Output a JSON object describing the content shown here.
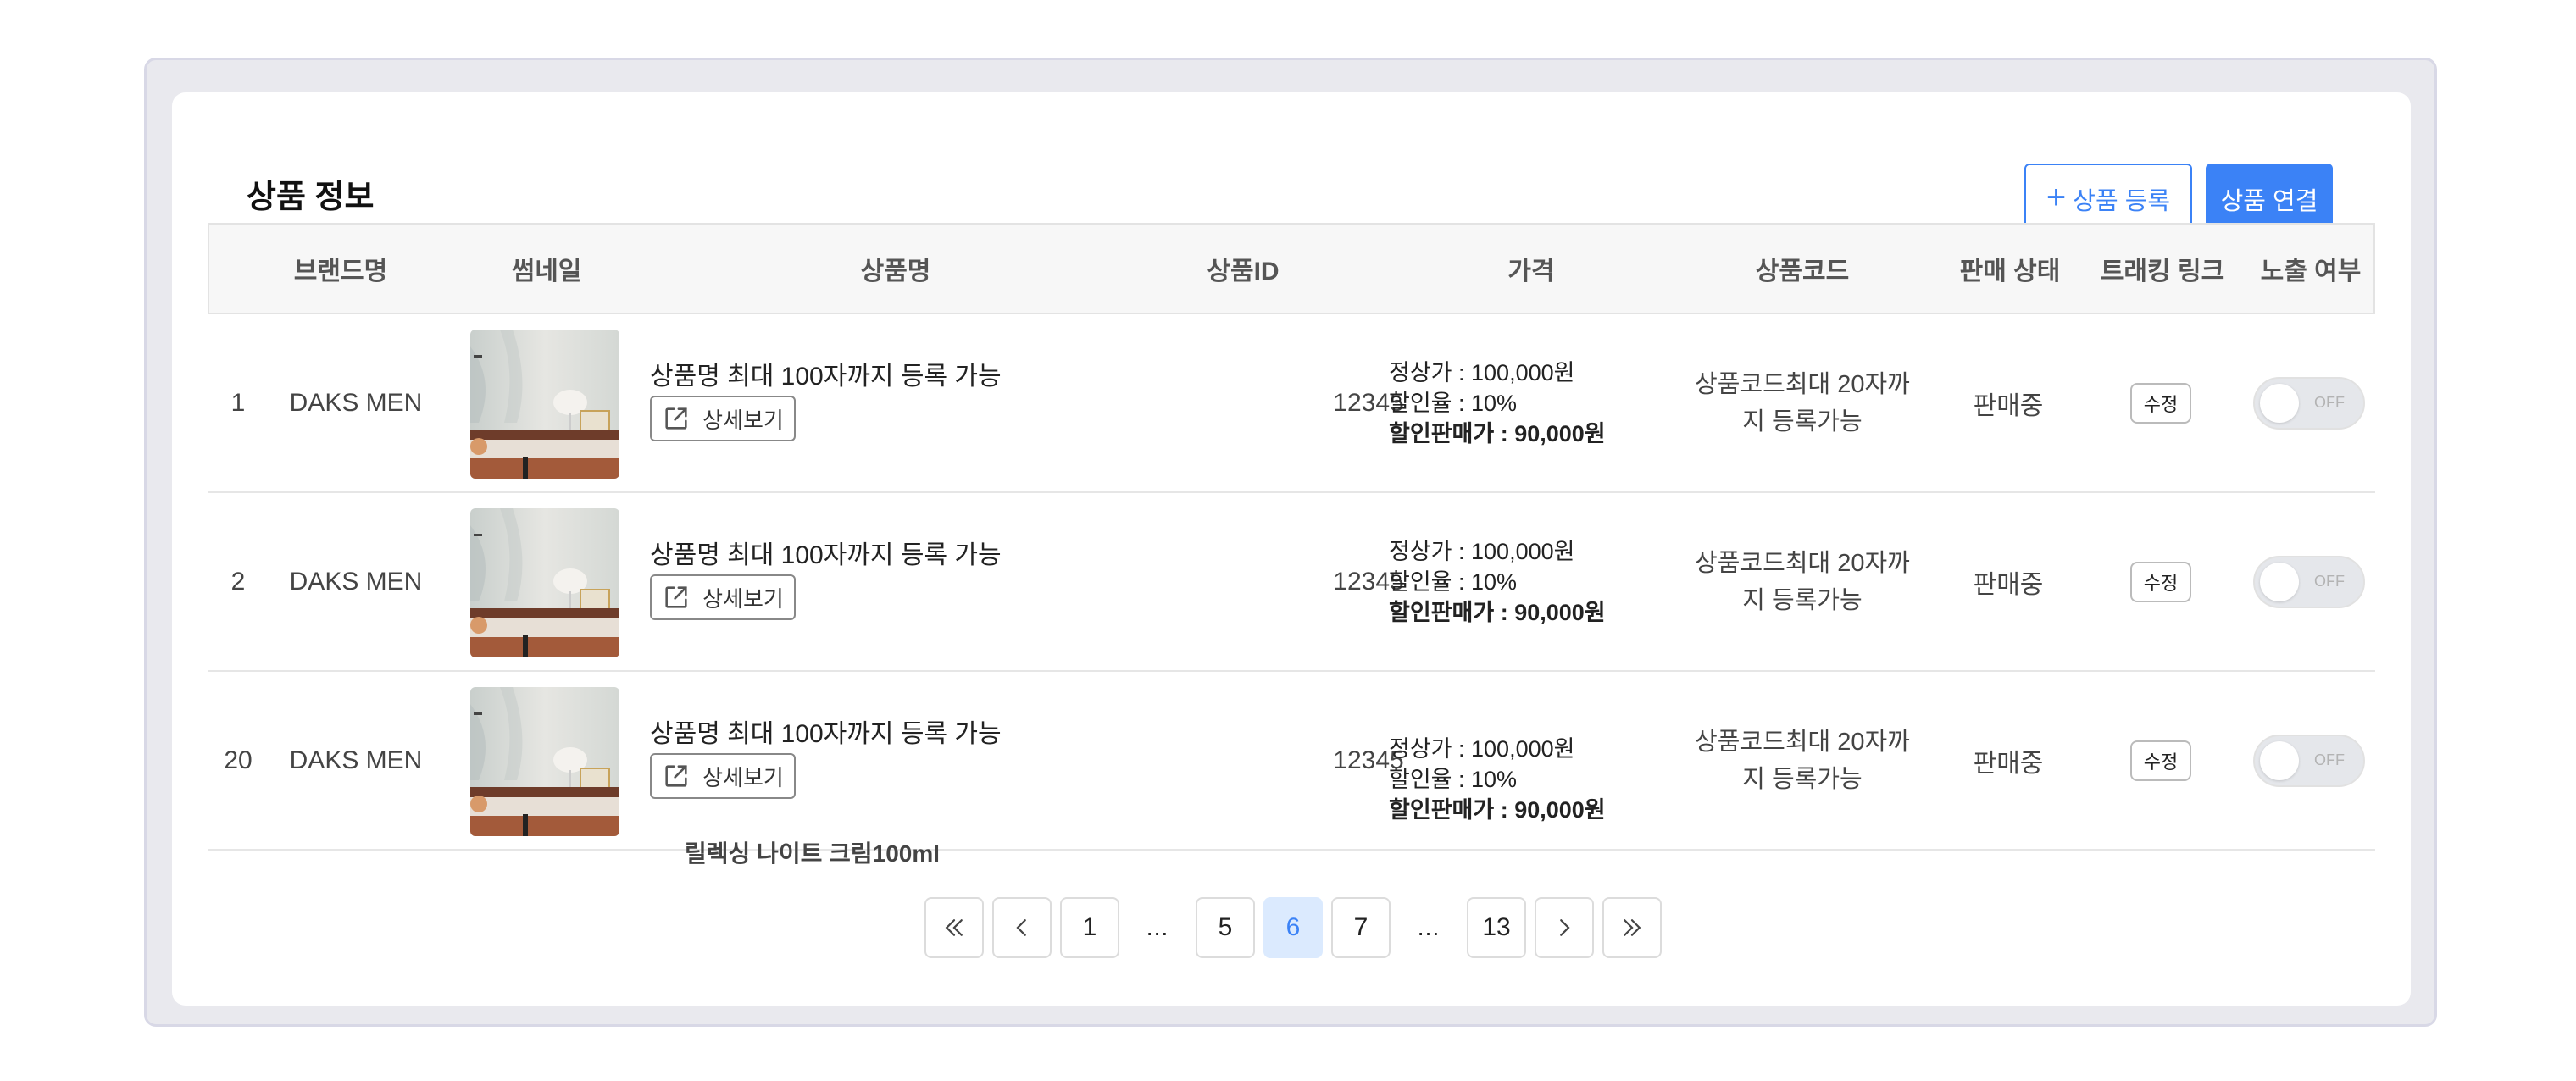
{
  "panel": {
    "title": "상품 정보",
    "register_label": "상품 등록",
    "connect_label": "상품 연결"
  },
  "columns": [
    "",
    "브랜드명",
    "썸네일",
    "상품명",
    "상품ID",
    "가격",
    "상품코드",
    "판매 상태",
    "트래킹 링크",
    "노출 여부"
  ],
  "rows": [
    {
      "no": "1",
      "brand": "DAKS MEN",
      "name": "상품명 최대 100자까지 등록 가능",
      "detail": "상세보기",
      "id": "12345",
      "list_price": "정상가 : 100,000원",
      "discount": "할인율 : 10%",
      "sale_price": "할인판매가 : 90,000원",
      "code_line1": "상품코드최대 20자까",
      "code_line2": "지 등록가능",
      "status": "판매중",
      "edit": "수정",
      "toggle": "OFF"
    },
    {
      "no": "2",
      "brand": "DAKS MEN",
      "name": "상품명 최대 100자까지 등록 가능",
      "detail": "상세보기",
      "id": "12345",
      "list_price": "정상가 : 100,000원",
      "discount": "할인율 : 10%",
      "sale_price": "할인판매가 : 90,000원",
      "code_line1": "상품코드최대 20자까",
      "code_line2": "지 등록가능",
      "status": "판매중",
      "edit": "수정",
      "toggle": "OFF"
    },
    {
      "no": "20",
      "brand": "DAKS MEN",
      "name": "상품명 최대 100자까지 등록 가능",
      "detail": "상세보기",
      "id": "12345",
      "list_price": "정상가 : 100,000원",
      "discount": "할인율 : 10%",
      "sale_price": "할인판매가 : 90,000원",
      "code_line1": "상품코드최대 20자까",
      "code_line2": "지 등록가능",
      "status": "판매중",
      "edit": "수정",
      "toggle": "OFF"
    }
  ],
  "tooltip": "릴렉싱 나이트 크림100ml",
  "pagination": {
    "pages": [
      "1",
      "…",
      "5",
      "6",
      "7",
      "…",
      "13"
    ],
    "current": "6"
  },
  "colors": {
    "accent": "#3b82f6",
    "active_page_bg": "#dbeafe"
  }
}
